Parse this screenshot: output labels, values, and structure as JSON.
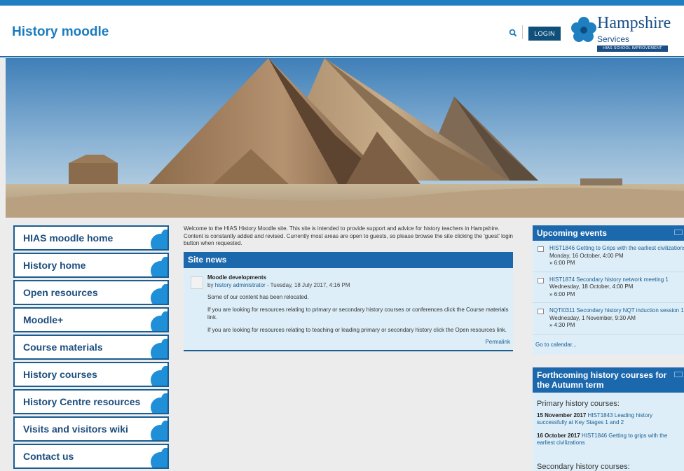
{
  "header": {
    "site_title": "History moodle",
    "login_label": "LOGIN",
    "logo": {
      "name": "Hampshire",
      "services": "Services",
      "tagline": "HIAS SCHOOL IMPROVEMENT"
    }
  },
  "nav": {
    "items": [
      {
        "label": "HIAS moodle home"
      },
      {
        "label": "History home"
      },
      {
        "label": "Open resources"
      },
      {
        "label": "Moodle+"
      },
      {
        "label": "Course materials"
      },
      {
        "label": "History courses"
      },
      {
        "label": "History Centre resources"
      },
      {
        "label": "Visits and visitors wiki"
      },
      {
        "label": "Contact us"
      }
    ]
  },
  "main": {
    "intro": "Welcome to the HIAS History Moodle site. This site is intended to provide support and advice for history teachers in Hampshire. Content is constantly added and revised. Currently most areas are open to guests, so please browse the site clicking the 'guest' login button when requested.",
    "site_news": {
      "heading": "Site news",
      "post": {
        "title": "Moodle developments",
        "by_prefix": "by",
        "author": "history administrator",
        "date": " - Tuesday, 18 July 2017, 4:16 PM",
        "p1": "Some of our content has been relocated.",
        "p2": "If you are looking for resources relating to primary or secondary history courses or conferences click the Course materials link.",
        "p3": "If you are looking for resources relating to teaching or leading primary or secondary history click the Open resources link.",
        "permalink": "Permalink"
      }
    }
  },
  "upcoming": {
    "heading": "Upcoming events",
    "events": [
      {
        "title": "HIST1846 Getting to Grips with the earliest civilizations",
        "date": "Monday, 16 October, 4:00 PM",
        "end": "» 6:00 PM"
      },
      {
        "title": "HIST1874 Secondary history network meeting 1",
        "date": "Wednesday, 18 October, 4:00 PM",
        "end": "» 6:00 PM"
      },
      {
        "title": "NQTI0311 Secondary history NQT induction session 1",
        "date": "Wednesday, 1 November, 9:30 AM",
        "end": "» 4:30 PM"
      }
    ],
    "go_to_calendar": "Go to calendar..."
  },
  "forthcoming": {
    "heading": "Forthcoming history courses for the Autumn term",
    "primary_heading": "Primary history courses:",
    "primary": [
      {
        "date": "15 November 2017",
        "title": "HIST1843 Leading history successfully at Key Stages 1 and 2"
      },
      {
        "date": "16 October 2017",
        "title": "HIST1846 Getting to grips with the earliest civilizations"
      }
    ],
    "secondary_heading": "Secondary history courses:"
  },
  "colors": {
    "accent": "#1c68ad",
    "nav_border": "#1a5d92",
    "title": "#1a7bbf"
  }
}
